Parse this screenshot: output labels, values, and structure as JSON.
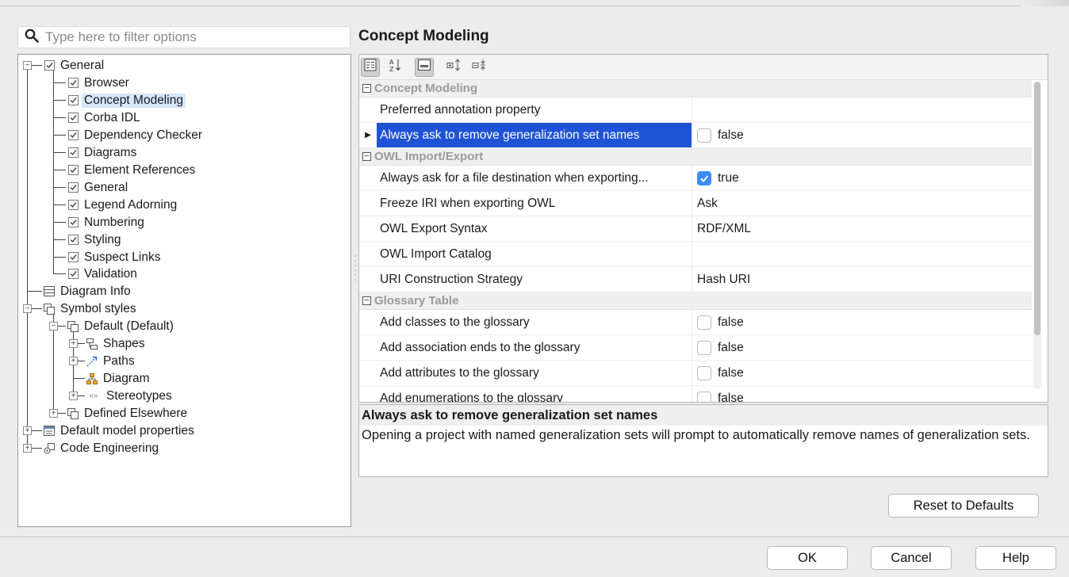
{
  "filter": {
    "placeholder": "Type here to filter options"
  },
  "tree": {
    "general": "General",
    "children": [
      "Browser",
      "Concept Modeling",
      "Corba IDL",
      "Dependency Checker",
      "Diagrams",
      "Element References",
      "General",
      "Legend Adorning",
      "Numbering",
      "Styling",
      "Suspect Links",
      "Validation"
    ],
    "diagram_info": "Diagram Info",
    "symbol_styles": "Symbol styles",
    "default": "Default (Default)",
    "shapes": "Shapes",
    "paths": "Paths",
    "diagram": "Diagram",
    "stereotypes": "Stereotypes",
    "defined_elsewhere": "Defined Elsewhere",
    "default_model_properties": "Default model properties",
    "code_engineering": "Code Engineering"
  },
  "panel": {
    "title": "Concept Modeling"
  },
  "properties": {
    "concept_modeling": {
      "label": "Concept Modeling",
      "rows": [
        {
          "name": "Preferred annotation property",
          "value": ""
        },
        {
          "name": "Always ask to remove generalization set names",
          "value": "false"
        }
      ]
    },
    "owl": {
      "label": "OWL Import/Export",
      "rows": [
        {
          "name": "Always ask for a file destination when exporting...",
          "value": "true"
        },
        {
          "name": "Freeze IRI when exporting OWL",
          "value": "Ask"
        },
        {
          "name": "OWL Export Syntax",
          "value": "RDF/XML"
        },
        {
          "name": "OWL Import Catalog",
          "value": ""
        },
        {
          "name": "URI Construction Strategy",
          "value": "Hash URI"
        }
      ]
    },
    "glossary": {
      "label": "Glossary Table",
      "rows": [
        {
          "name": "Add classes to the glossary",
          "value": "false"
        },
        {
          "name": "Add association ends to the glossary",
          "value": "false"
        },
        {
          "name": "Add attributes to the glossary",
          "value": "false"
        },
        {
          "name": "Add enumerations to the glossary",
          "value": "false"
        }
      ]
    }
  },
  "description": {
    "title": "Always ask to remove generalization set names",
    "body": "Opening a project with named generalization sets will prompt to automatically remove names of generalization sets."
  },
  "buttons": {
    "reset": "Reset to Defaults",
    "ok": "OK",
    "cancel": "Cancel",
    "help": "Help"
  },
  "colors": {
    "selection": "#1f53d6",
    "tree_selection": "#d6e6fb",
    "checkbox_on": "#3d8bf5"
  },
  "icons": {
    "filter": "search-icon",
    "toolbar": [
      "categorized-view-icon",
      "sort-alphabetically-icon",
      "description-toggle-icon",
      "expand-all-icon",
      "collapse-all-icon"
    ]
  }
}
